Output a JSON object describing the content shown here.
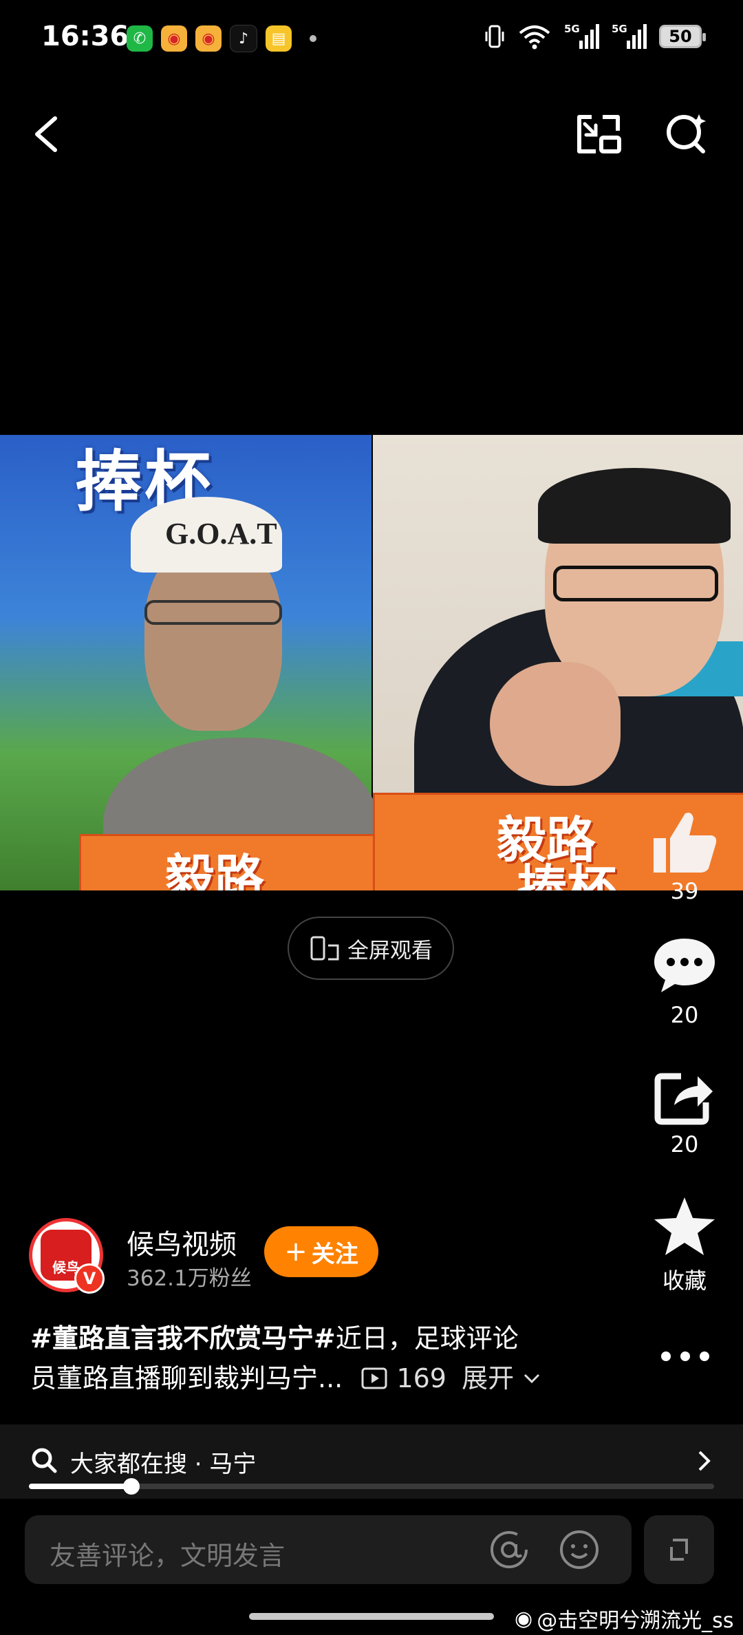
{
  "status_bar": {
    "time": "16:36",
    "network_1": "5G",
    "network_2": "5G",
    "battery": "50",
    "notifications": [
      "wechat-icon",
      "weibo-icon",
      "weibo-icon",
      "tiktok-icon",
      "notes-icon"
    ]
  },
  "video": {
    "left_banner": "捧杯",
    "cap_text": "G.O.A.T",
    "box_text_left": "毅路",
    "box_text_right": "毅路",
    "box_text_right_2": "捧杯"
  },
  "fullscreen_label": "全屏观看",
  "actions": {
    "like_count": "39",
    "comment_count": "20",
    "share_count": "20",
    "favorite_label": "收藏"
  },
  "author": {
    "avatar_text": "候鸟",
    "name": "候鸟视频",
    "fans": "362.1万粉丝",
    "follow_label": "关注"
  },
  "description": {
    "hashtag": "#董路直言我不欣赏马宁#",
    "text_line1": "近日，足球评论",
    "text_line2": "员董路直播聊到裁判马宁...",
    "play_count": "169",
    "expand_label": "展开"
  },
  "search_hint": "大家都在搜 · 马宁",
  "progress": 0.15,
  "comment_placeholder": "友善评论，文明发言",
  "watermark": "@击空明兮溯流光_ss",
  "colors": {
    "accent": "#ff8200",
    "background": "#000000"
  }
}
